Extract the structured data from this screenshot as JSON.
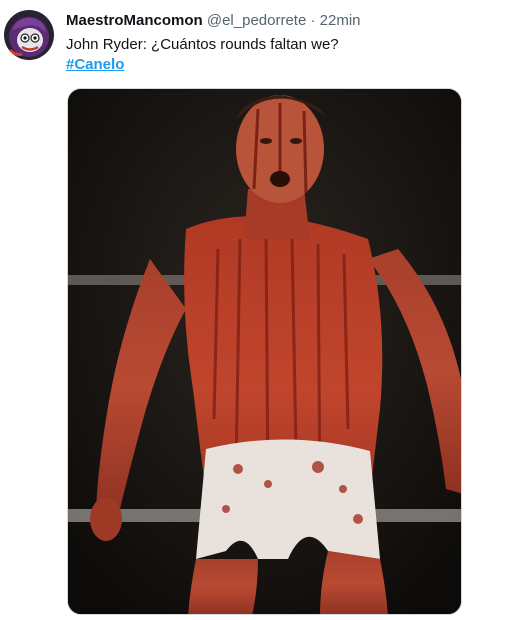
{
  "tweet": {
    "display_name": "MaestroMancomon",
    "handle": "@el_pedorrete",
    "separator": "·",
    "timestamp": "22min",
    "text": "John Ryder: ¿Cuántos rounds faltan we?",
    "hashtag": "#Canelo"
  },
  "colors": {
    "link": "#1d9bf0",
    "secondary_text": "#536471",
    "primary_text": "#0f1419",
    "border": "#cfd9de"
  }
}
